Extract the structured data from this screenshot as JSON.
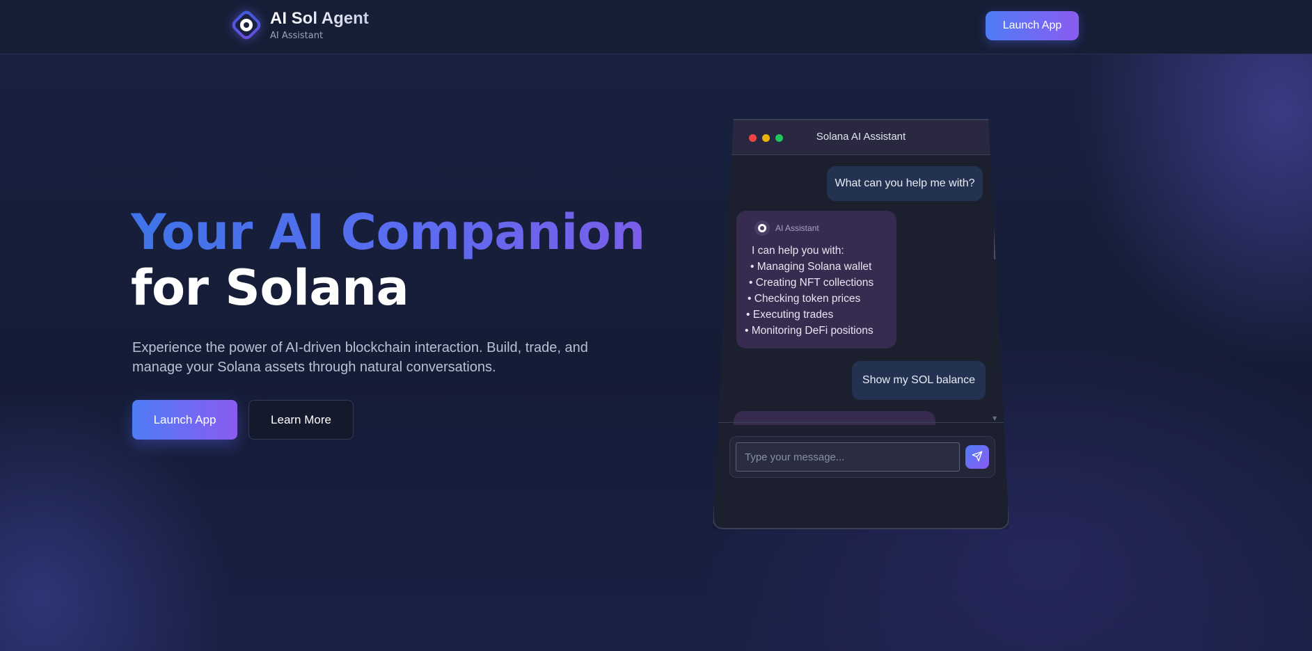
{
  "nav": {
    "brand_title": "AI Sol Agent",
    "brand_subtitle": "AI Assistant",
    "launch_label": "Launch App"
  },
  "hero": {
    "title_line1": "Your AI Companion",
    "title_line2": "for Solana",
    "description": "Experience the power of AI-driven blockchain interaction. Build, trade, and manage your Solana assets through natural conversations.",
    "primary_label": "Launch App",
    "secondary_label": "Learn More"
  },
  "chat": {
    "window_title": "Solana AI Assistant",
    "messages": [
      {
        "role": "user",
        "text": "What can you help me with?"
      },
      {
        "role": "assistant",
        "sender": "AI Assistant",
        "lines": [
          "I can help you with:",
          "• Managing Solana wallet",
          "• Creating NFT collections",
          "• Checking token prices",
          "• Executing trades",
          "• Monitoring DeFi positions"
        ]
      },
      {
        "role": "user",
        "text": "Show my SOL balance"
      }
    ],
    "input_placeholder": "Type your message...",
    "input_value": ""
  },
  "colors": {
    "accent_start": "#4f7cf7",
    "accent_end": "#8a5cf0",
    "background": "#151c36",
    "user_bubble": "#243251",
    "assistant_bubble": "#372c50"
  },
  "icons": {
    "logo": "target-logo-icon",
    "send": "send-arrow-icon"
  }
}
